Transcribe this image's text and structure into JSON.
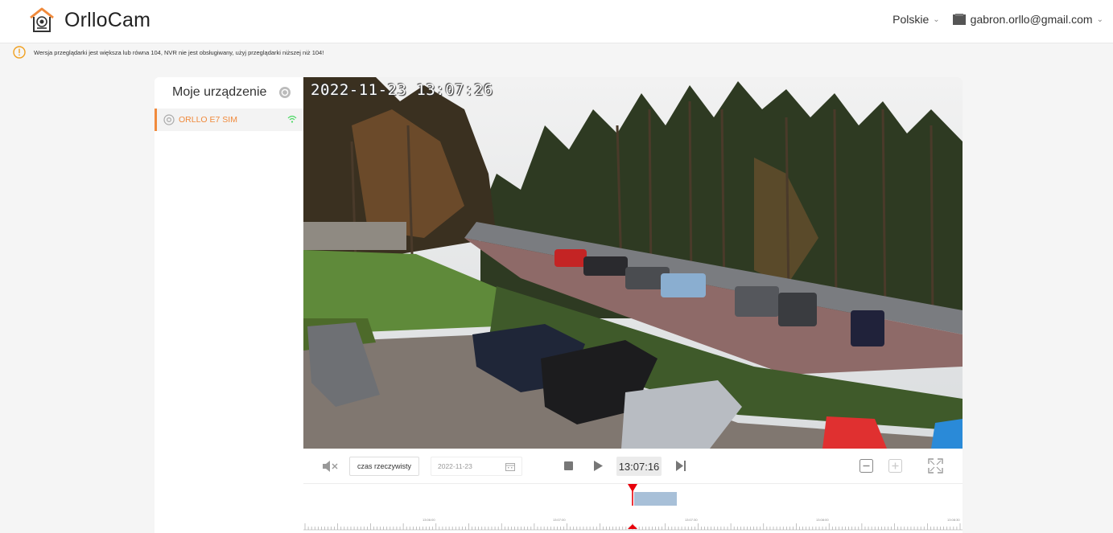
{
  "app": {
    "name": "OrlloCam"
  },
  "header": {
    "language": "Polskie",
    "user_email": "gabron.orllo@gmail.com"
  },
  "warning": {
    "text": "Wersja przeglądarki jest większa lub równa 104, NVR nie jest obsługiwany, użyj przeglądarki niższej niż 104!"
  },
  "sidebar": {
    "title": "Moje urządzenie",
    "devices": [
      {
        "label": "ORLLO E7 SIM"
      }
    ]
  },
  "video": {
    "osd_timestamp": "2022-11-23 13:07:26"
  },
  "controls": {
    "mode_label": "czas rzeczywisty",
    "date_value": "2022-11-23",
    "current_time": "13:07:16"
  },
  "timeline": {
    "tick_labels": [
      "13:06:00",
      "13:07:00",
      "13:07:30",
      "13:08:00",
      "13:08:30"
    ]
  },
  "colors": {
    "accent": "#f08a3c",
    "playhead": "#e8000b",
    "recorded": "#a8c0d8"
  }
}
